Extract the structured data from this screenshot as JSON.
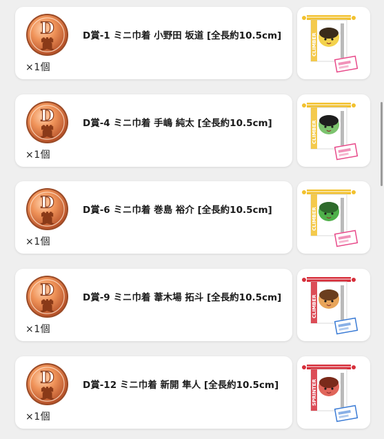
{
  "badge": {
    "letter": "D",
    "kanji": "賞"
  },
  "items": [
    {
      "title": "D賞-1 ミニ巾着 小野田 坂道 [全長約10.5cm]",
      "quantity": "×1個",
      "ribbon_color": "#f2c12e",
      "side_text": "CLIMBER",
      "face_color": "#f3d24c",
      "hair_color": "#3a2a1a",
      "tag_color": "#e84a8a"
    },
    {
      "title": "D賞-4 ミニ巾着 手嶋 純太 [全長約10.5cm]",
      "quantity": "×1個",
      "ribbon_color": "#f2c12e",
      "side_text": "CLIMBER",
      "face_color": "#7cc36e",
      "hair_color": "#1e1e1e",
      "tag_color": "#e84a8a"
    },
    {
      "title": "D賞-6 ミニ巾着 巻島 裕介 [全長約10.5cm]",
      "quantity": "×1個",
      "ribbon_color": "#f2c12e",
      "side_text": "CLIMBER",
      "face_color": "#4fb04a",
      "hair_color": "#2f6b2c",
      "tag_color": "#e84a8a"
    },
    {
      "title": "D賞-9 ミニ巾着 葦木場 拓斗 [全長約10.5cm]",
      "quantity": "×1個",
      "ribbon_color": "#d62e3a",
      "side_text": "CLIMBER",
      "face_color": "#e8a55a",
      "hair_color": "#6b3e1e",
      "tag_color": "#3a7bd5"
    },
    {
      "title": "D賞-12 ミニ巾着 新開 隼人 [全長約10.5cm]",
      "quantity": "×1個",
      "ribbon_color": "#d62e3a",
      "side_text": "SPRINTER",
      "face_color": "#e0655a",
      "hair_color": "#7a2a1a",
      "tag_color": "#3a7bd5"
    }
  ]
}
